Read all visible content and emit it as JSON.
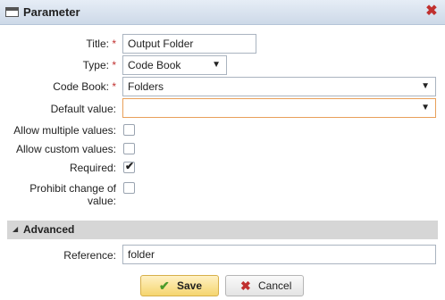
{
  "dialog": {
    "title": "Parameter",
    "icon": "window-icon",
    "close_icon": "close-icon"
  },
  "form": {
    "title": {
      "label": "Title:",
      "required": "*",
      "value": "Output Folder"
    },
    "type": {
      "label": "Type:",
      "required": "*",
      "value": "Code Book"
    },
    "code_book": {
      "label": "Code Book:",
      "required": "*",
      "value": "Folders"
    },
    "default_value": {
      "label": "Default value:",
      "value": ""
    },
    "allow_multiple": {
      "label": "Allow multiple values:",
      "checked": false
    },
    "allow_custom": {
      "label": "Allow custom values:",
      "checked": false
    },
    "required": {
      "label": "Required:",
      "checked": true,
      "check_glyph": "✔"
    },
    "prohibit_change": {
      "label_line1": "Prohibit change of",
      "label_line2": "value:",
      "checked": false
    }
  },
  "advanced": {
    "header": "Advanced",
    "reference": {
      "label": "Reference:",
      "value": "folder"
    }
  },
  "buttons": {
    "save": "Save",
    "cancel": "Cancel"
  },
  "colors": {
    "required_mark": "#c0302f",
    "focus_border": "#e8a05a",
    "save_bg": "#f5d56e"
  }
}
